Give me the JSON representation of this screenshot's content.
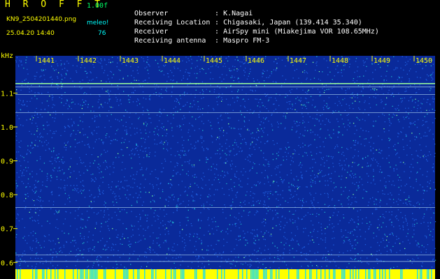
{
  "header": {
    "brand": "H R O F F T",
    "version": "1.00f",
    "filename": "KN9_2504201440.png",
    "meleo_label": "meleo!",
    "timestamp": "25.04.20 14:40",
    "meleo_count": "76"
  },
  "info": [
    {
      "label": "Observer",
      "value": ": K.Nagai"
    },
    {
      "label": "Receiving Location",
      "value": ": Chigasaki, Japan (139.414 35.340)"
    },
    {
      "label": "Receiver",
      "value": ": AirSpy mini (Miakejima VOR 108.65MHz)"
    },
    {
      "label": "Receiving antenna",
      "value": ": Maspro FM-3"
    }
  ],
  "colors": {
    "background": "#000000",
    "spectrogram_base": "#0a2a9a",
    "spectrogram_noise": "#1f5fe0",
    "signal_cyan": "#26e0e0",
    "signal_yellow": "#ffff00",
    "axis_text": "#ffff00"
  },
  "chart_data": {
    "type": "heatmap",
    "ylabel": "kHz",
    "x_ticks": [
      "1441",
      "1442",
      "1443",
      "1444",
      "1445",
      "1446",
      "1447",
      "1448",
      "1449",
      "1450"
    ],
    "y_ticks": [
      "1.1",
      "1.0",
      "0.9",
      "0.8",
      "0.7",
      "0.6"
    ],
    "y_tick_values": [
      1.1,
      1.0,
      0.9,
      0.8,
      0.7,
      0.6
    ],
    "x_range": [
      1440.5,
      1450.5
    ],
    "y_range": [
      0.58,
      1.21
    ],
    "horizontal_lines_khz": [
      1.128,
      1.118,
      1.096,
      1.042,
      0.762,
      0.622,
      0.603
    ]
  }
}
